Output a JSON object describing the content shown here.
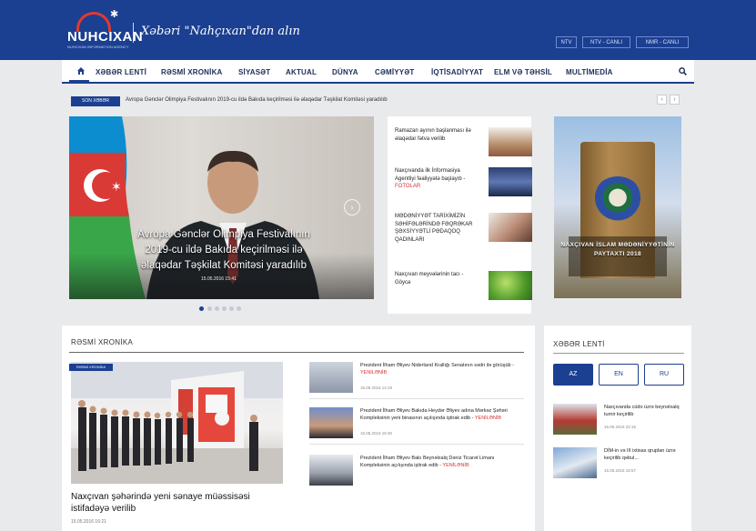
{
  "header": {
    "logo_text": "NUHCIXAN",
    "logo_subtext": "NUHCIXAN INFORMATION AGENCY",
    "tagline": "Xəbəri \"Nahçıxan\"dan alın",
    "live_buttons": [
      "NTV",
      "NTV - CANLI",
      "NMR - CANLI"
    ],
    "brand_color": "#1b3f91",
    "accent_color": "#d73131"
  },
  "nav": {
    "items": [
      "XƏBƏR LENTİ",
      "RƏSMİ XRONİKA",
      "SİYASƏT",
      "AKTUAL",
      "DÜNYA",
      "CƏMİYYƏT",
      "İQTİSADİYYAT",
      "ELM VƏ TƏHSİL",
      "MULTİMEDİA"
    ],
    "home_icon": "home-icon",
    "search_icon": "search-icon"
  },
  "ticker": {
    "badge": "SON XƏBƏR",
    "text": "Avropa Gənclər Olimpiya Festivalının 2019-cu ildə Bakıda keçirilməsi ilə əlaqədar Təşkilat Komitəsi yaradılıb"
  },
  "slider": {
    "caption": "Avropa Gənclər Olimpiya Festivalının 2019-cu ildə Bakıda keçirilməsi ilə əlaqədar Təşkilat Komitəsi yaradılıb",
    "date": "15.05.2016 15:41",
    "dots_active": 1,
    "dots_total": 6
  },
  "side_news": [
    {
      "title": "Ramazan ayının başlanması ilə əlaqədar fətva verilib",
      "tag": ""
    },
    {
      "title": "Naxçıvanda ilk İnformasiya Agentliyi fəaliyyətə başlayıb -",
      "tag": "FOTOLAR"
    },
    {
      "title": "MƏDƏNİYYƏT TARİXİMİZİN SƏHİFƏLƏRİNDƏ FƏQRƏKAR ŞƏXSİYYƏTLİ PƏDAQOQ QADINLARI",
      "tag": ""
    },
    {
      "title": "Naxçıvan meyvələrinin tacı - Göycə",
      "tag": ""
    }
  ],
  "poster": {
    "text": "NAXÇIVAN İSLAM MƏDƏNİYYƏTİNİN PAYTAXTI 2018"
  },
  "chronicle": {
    "title": "RƏSMİ XRONİKA",
    "badge": "RƏSMİ XRONİKA",
    "main_headline": "Naxçıvan şəhərində yeni sənaye müəssisəsi istifadəyə verilib",
    "main_date": "15.05.2016 16:21",
    "items": [
      {
        "text": "Prezident İlham Əliyev Niderland Krallığı Senatının sədri ilə görüşüb -",
        "tag": "YENİLƏNİB",
        "date": "15.05.2016 14:19"
      },
      {
        "text": "Prezident İlham Əliyev Bakıda Heydər Əliyev adına Mərkəz Şəhəri Kompleksinin yeni binasının açılışında iştirak edib -",
        "tag": "YENİLƏNİB",
        "date": "15.05.2016 16:30"
      },
      {
        "text": "Prezident İlham Əliyev Bakı Beynəlxalq Dəniz Ticarət Limanı Kompleksinin açılışında iştirak edib -",
        "tag": "YENİLƏNİB",
        "date": ""
      }
    ]
  },
  "feed": {
    "title": "XƏBƏR LENTİ",
    "languages": [
      "AZ",
      "EN",
      "RU"
    ],
    "active_language": "AZ",
    "items": [
      {
        "text": "Naxçıvanda cüdo üzrə beynəlxalq turnir keçirilib",
        "date": "15.05.2016 22:15"
      },
      {
        "text": "DİM-in və III ixtisas qruplan üzrə keçirilib qəbul...",
        "date": "15.05.2016 18:57"
      }
    ]
  }
}
